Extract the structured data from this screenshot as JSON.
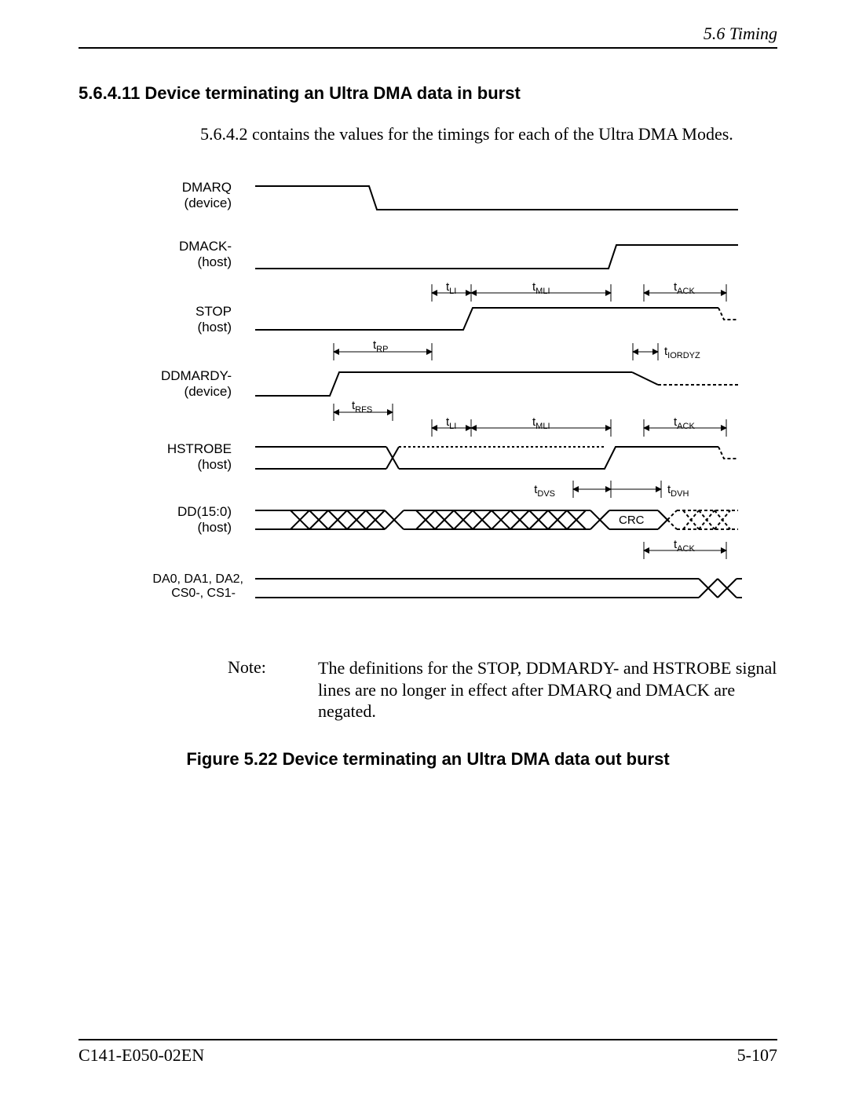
{
  "header": {
    "section": "5.6  Timing"
  },
  "section": {
    "title": "5.6.4.11 Device terminating an Ultra DMA data in burst"
  },
  "intro": {
    "text": "5.6.4.2 contains the values for the timings for each of the Ultra DMA Modes."
  },
  "diagram": {
    "signals": {
      "dmarq": {
        "l1": "DMARQ",
        "l2": "(device)"
      },
      "dmack": {
        "l1": "DMACK-",
        "l2": "(host)"
      },
      "stop": {
        "l1": "STOP",
        "l2": "(host)"
      },
      "ddmardy": {
        "l1": "DDMARDY-",
        "l2": "(device)"
      },
      "hstrobe": {
        "l1": "HSTROBE",
        "l2": "(host)"
      },
      "dd": {
        "l1": "DD(15:0)",
        "l2": "(host)"
      },
      "da": {
        "l1": "DA0, DA1, DA2,",
        "l2": "CS0-, CS1-"
      }
    },
    "timings": {
      "tLI": "t",
      "tLI_sub": "LI",
      "tMLI": "t",
      "tMLI_sub": "MLI",
      "tACK": "t",
      "tACK_sub": "ACK",
      "tRP": "t",
      "tRP_sub": "RP",
      "tIORDYZ": "t",
      "tIORDYZ_sub": "IORDYZ",
      "tRFS": "t",
      "tRFS_sub": "RFS",
      "tDVS": "t",
      "tDVS_sub": "DVS",
      "tDVH": "t",
      "tDVH_sub": "DVH",
      "crc": "CRC"
    }
  },
  "note": {
    "label": "Note:",
    "text": "The definitions for the STOP, DDMARDY- and HSTROBE signal lines are no longer in effect after DMARQ and DMACK are negated."
  },
  "figure": {
    "caption": "Figure 5.22  Device terminating an Ultra DMA data out burst"
  },
  "footer": {
    "doc": "C141-E050-02EN",
    "page": "5-107"
  }
}
